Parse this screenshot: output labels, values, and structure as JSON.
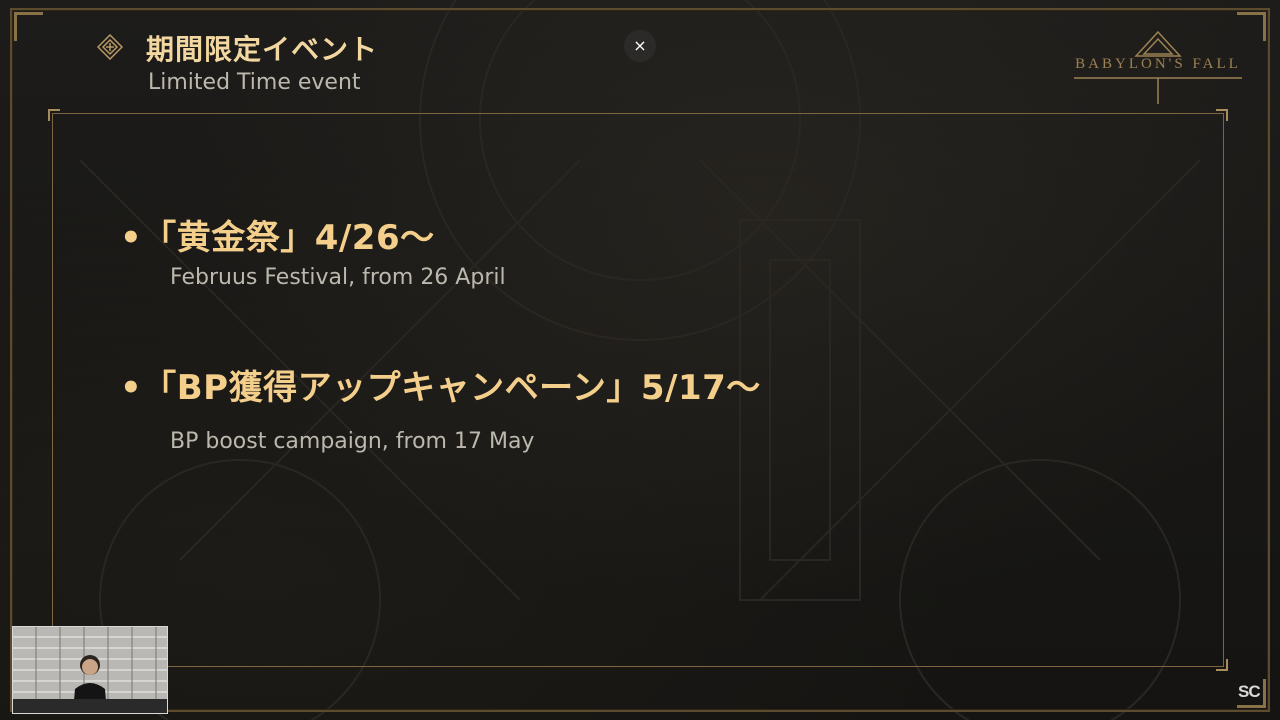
{
  "header": {
    "title_jp": "期間限定イベント",
    "title_en": "Limited Time event",
    "close_symbol": "×"
  },
  "logo": {
    "text": "BABYLON'S FALL"
  },
  "events": [
    {
      "title": "•「黄金祭」4/26～",
      "subtitle": "Februus Festival, from 26 April"
    },
    {
      "title": "•「BP獲得アップキャンペーン」5/17～",
      "subtitle": "BP boost campaign, from 17 May"
    }
  ],
  "watermark": {
    "text": "SC"
  },
  "colors": {
    "accent_gold": "#f4cf8c",
    "frame_gold": "#7b6642",
    "subtitle_gray": "#bdb8ae",
    "background": "#1a1917"
  },
  "icons": {
    "header": "diamond-emblem-icon",
    "close": "close-icon"
  }
}
